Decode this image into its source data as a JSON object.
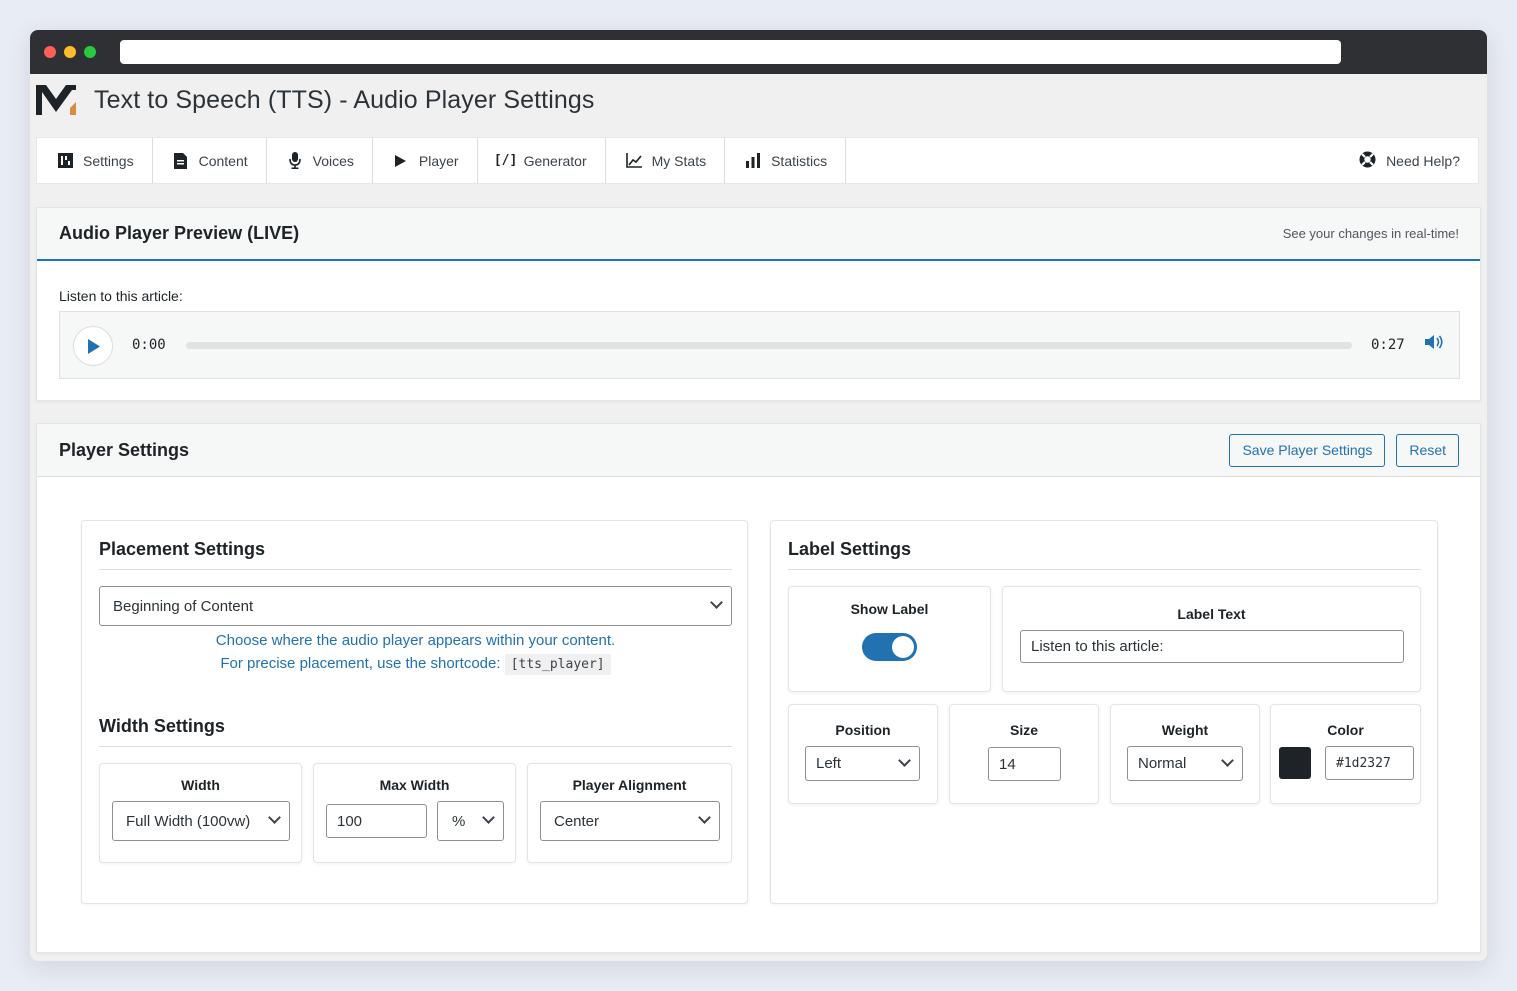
{
  "app": {
    "title": "Text to Speech (TTS) - Audio Player Settings",
    "logo_icon": "m-logo-icon"
  },
  "nav": {
    "tabs": [
      {
        "label": "Settings",
        "icon": "settings-icon"
      },
      {
        "label": "Content",
        "icon": "document-icon"
      },
      {
        "label": "Voices",
        "icon": "microphone-icon"
      },
      {
        "label": "Player",
        "icon": "play-icon"
      },
      {
        "label": "Generator",
        "icon": "code-icon"
      },
      {
        "label": "My Stats",
        "icon": "chart-line-icon"
      },
      {
        "label": "Statistics",
        "icon": "bar-chart-icon"
      }
    ],
    "help_label": "Need Help?",
    "help_icon": "lifebuoy-icon"
  },
  "preview": {
    "title": "Audio Player Preview (LIVE)",
    "subtitle": "See your changes in real-time!",
    "listen_label": "Listen to this article:",
    "current_time": "0:00",
    "duration": "0:27",
    "progress": 0
  },
  "player_settings": {
    "title": "Player Settings",
    "save_label": "Save Player Settings",
    "reset_label": "Reset"
  },
  "placement": {
    "title": "Placement Settings",
    "selected": "Beginning of Content",
    "help_line1": "Choose where the audio player appears within your content.",
    "help_line2": "For precise placement, use the shortcode:",
    "shortcode": "[tts_player]"
  },
  "width": {
    "title": "Width Settings",
    "width_label": "Width",
    "width_value": "Full Width (100vw)",
    "max_width_label": "Max Width",
    "max_width_value": "100",
    "max_width_unit": "%",
    "alignment_label": "Player Alignment",
    "alignment_value": "Center"
  },
  "label_settings": {
    "title": "Label Settings",
    "show_label": "Show Label",
    "show_label_on": true,
    "label_text_label": "Label Text",
    "label_text_value": "Listen to this article:",
    "position_label": "Position",
    "position_value": "Left",
    "size_label": "Size",
    "size_value": "14",
    "weight_label": "Weight",
    "weight_value": "Normal",
    "color_label": "Color",
    "color_value": "#1d2327"
  },
  "colors": {
    "accent": "#2271b1",
    "text": "#1d2327",
    "bg": "#f0f0f1"
  }
}
